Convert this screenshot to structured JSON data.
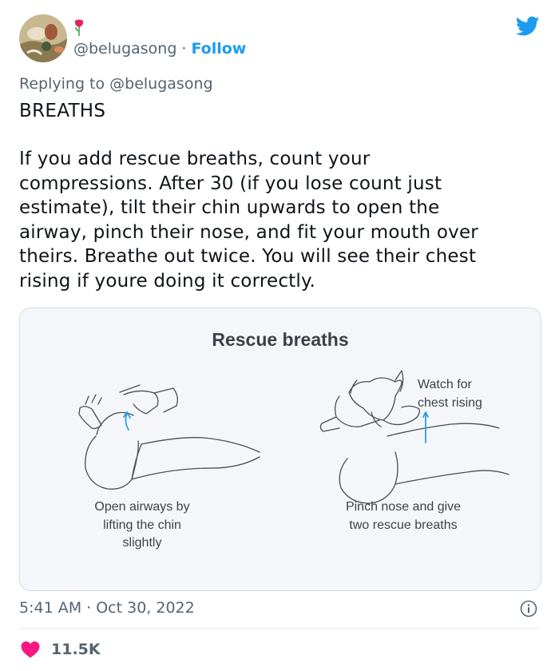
{
  "author": {
    "handle": "@belugasong",
    "separator": "·",
    "follow_label": "Follow",
    "avatar_icon": "painting-avatar",
    "badge_icon": "rose-emoji"
  },
  "brand_icon": "twitter-bird-icon",
  "reply": {
    "text": "Replying to @belugasong"
  },
  "tweet": {
    "heading": "BREATHS",
    "body": "If you add rescue breaths, count your\ncompressions. After 30 (if you lose count just\nestimate), tilt their chin upwards to open the\nairway, pinch their nose, and fit your mouth over\ntheirs. Breathe out twice. You will see their chest\nrising if youre doing it correctly."
  },
  "media": {
    "title": "Rescue breaths",
    "caption_left": "Open airways by\nlifting the chin\nslightly",
    "caption_right": "Pinch nose and give\ntwo rescue breaths",
    "caption_arrow": "Watch for\nchest rising"
  },
  "meta": {
    "timestamp": "5:41 AM · Oct 30, 2022",
    "info_icon": "info-icon"
  },
  "stats": {
    "likes": "11.5K",
    "like_icon": "heart-icon"
  },
  "colors": {
    "link": "#1d9bf0",
    "heart": "#f91880",
    "muted": "#536471"
  }
}
